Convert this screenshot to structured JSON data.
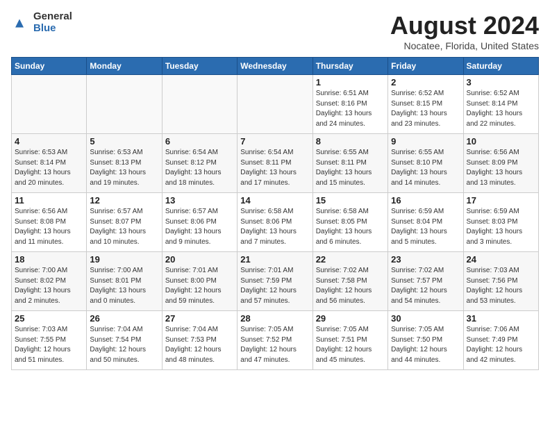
{
  "logo": {
    "general": "General",
    "blue": "Blue"
  },
  "header": {
    "title": "August 2024",
    "subtitle": "Nocatee, Florida, United States"
  },
  "weekdays": [
    "Sunday",
    "Monday",
    "Tuesday",
    "Wednesday",
    "Thursday",
    "Friday",
    "Saturday"
  ],
  "weeks": [
    [
      {
        "day": "",
        "info": ""
      },
      {
        "day": "",
        "info": ""
      },
      {
        "day": "",
        "info": ""
      },
      {
        "day": "",
        "info": ""
      },
      {
        "day": "1",
        "info": "Sunrise: 6:51 AM\nSunset: 8:16 PM\nDaylight: 13 hours\nand 24 minutes."
      },
      {
        "day": "2",
        "info": "Sunrise: 6:52 AM\nSunset: 8:15 PM\nDaylight: 13 hours\nand 23 minutes."
      },
      {
        "day": "3",
        "info": "Sunrise: 6:52 AM\nSunset: 8:14 PM\nDaylight: 13 hours\nand 22 minutes."
      }
    ],
    [
      {
        "day": "4",
        "info": "Sunrise: 6:53 AM\nSunset: 8:14 PM\nDaylight: 13 hours\nand 20 minutes."
      },
      {
        "day": "5",
        "info": "Sunrise: 6:53 AM\nSunset: 8:13 PM\nDaylight: 13 hours\nand 19 minutes."
      },
      {
        "day": "6",
        "info": "Sunrise: 6:54 AM\nSunset: 8:12 PM\nDaylight: 13 hours\nand 18 minutes."
      },
      {
        "day": "7",
        "info": "Sunrise: 6:54 AM\nSunset: 8:11 PM\nDaylight: 13 hours\nand 17 minutes."
      },
      {
        "day": "8",
        "info": "Sunrise: 6:55 AM\nSunset: 8:11 PM\nDaylight: 13 hours\nand 15 minutes."
      },
      {
        "day": "9",
        "info": "Sunrise: 6:55 AM\nSunset: 8:10 PM\nDaylight: 13 hours\nand 14 minutes."
      },
      {
        "day": "10",
        "info": "Sunrise: 6:56 AM\nSunset: 8:09 PM\nDaylight: 13 hours\nand 13 minutes."
      }
    ],
    [
      {
        "day": "11",
        "info": "Sunrise: 6:56 AM\nSunset: 8:08 PM\nDaylight: 13 hours\nand 11 minutes."
      },
      {
        "day": "12",
        "info": "Sunrise: 6:57 AM\nSunset: 8:07 PM\nDaylight: 13 hours\nand 10 minutes."
      },
      {
        "day": "13",
        "info": "Sunrise: 6:57 AM\nSunset: 8:06 PM\nDaylight: 13 hours\nand 9 minutes."
      },
      {
        "day": "14",
        "info": "Sunrise: 6:58 AM\nSunset: 8:06 PM\nDaylight: 13 hours\nand 7 minutes."
      },
      {
        "day": "15",
        "info": "Sunrise: 6:58 AM\nSunset: 8:05 PM\nDaylight: 13 hours\nand 6 minutes."
      },
      {
        "day": "16",
        "info": "Sunrise: 6:59 AM\nSunset: 8:04 PM\nDaylight: 13 hours\nand 5 minutes."
      },
      {
        "day": "17",
        "info": "Sunrise: 6:59 AM\nSunset: 8:03 PM\nDaylight: 13 hours\nand 3 minutes."
      }
    ],
    [
      {
        "day": "18",
        "info": "Sunrise: 7:00 AM\nSunset: 8:02 PM\nDaylight: 13 hours\nand 2 minutes."
      },
      {
        "day": "19",
        "info": "Sunrise: 7:00 AM\nSunset: 8:01 PM\nDaylight: 13 hours\nand 0 minutes."
      },
      {
        "day": "20",
        "info": "Sunrise: 7:01 AM\nSunset: 8:00 PM\nDaylight: 12 hours\nand 59 minutes."
      },
      {
        "day": "21",
        "info": "Sunrise: 7:01 AM\nSunset: 7:59 PM\nDaylight: 12 hours\nand 57 minutes."
      },
      {
        "day": "22",
        "info": "Sunrise: 7:02 AM\nSunset: 7:58 PM\nDaylight: 12 hours\nand 56 minutes."
      },
      {
        "day": "23",
        "info": "Sunrise: 7:02 AM\nSunset: 7:57 PM\nDaylight: 12 hours\nand 54 minutes."
      },
      {
        "day": "24",
        "info": "Sunrise: 7:03 AM\nSunset: 7:56 PM\nDaylight: 12 hours\nand 53 minutes."
      }
    ],
    [
      {
        "day": "25",
        "info": "Sunrise: 7:03 AM\nSunset: 7:55 PM\nDaylight: 12 hours\nand 51 minutes."
      },
      {
        "day": "26",
        "info": "Sunrise: 7:04 AM\nSunset: 7:54 PM\nDaylight: 12 hours\nand 50 minutes."
      },
      {
        "day": "27",
        "info": "Sunrise: 7:04 AM\nSunset: 7:53 PM\nDaylight: 12 hours\nand 48 minutes."
      },
      {
        "day": "28",
        "info": "Sunrise: 7:05 AM\nSunset: 7:52 PM\nDaylight: 12 hours\nand 47 minutes."
      },
      {
        "day": "29",
        "info": "Sunrise: 7:05 AM\nSunset: 7:51 PM\nDaylight: 12 hours\nand 45 minutes."
      },
      {
        "day": "30",
        "info": "Sunrise: 7:05 AM\nSunset: 7:50 PM\nDaylight: 12 hours\nand 44 minutes."
      },
      {
        "day": "31",
        "info": "Sunrise: 7:06 AM\nSunset: 7:49 PM\nDaylight: 12 hours\nand 42 minutes."
      }
    ]
  ]
}
